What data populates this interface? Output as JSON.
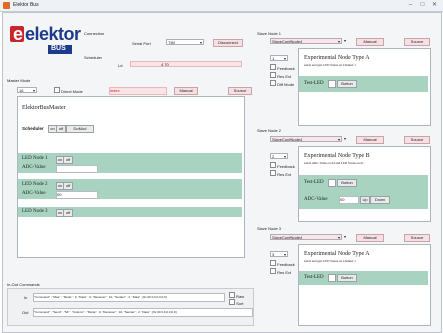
{
  "window": {
    "title": "Elektor Bus",
    "min": "–",
    "max": "□",
    "close": "✕"
  },
  "colors": {
    "accent_red": "#c8262a",
    "node_green": "#a8d3c1",
    "pink": "#f7e0e3"
  },
  "logo": {
    "text": "elektor",
    "sub": "BUS"
  },
  "connection": {
    "title": "Connection",
    "port_label": "Serial Port",
    "port_value": "TIM",
    "disconnect": "Disconnect"
  },
  "scheduler": {
    "title": "Scheduler",
    "label": "Ld",
    "value": "4 70"
  },
  "master_mode": {
    "title": "Master Mode",
    "mode_value": "16",
    "direct_mode": "Direct Mode",
    "cmd_value": "index",
    "manual": "Manual",
    "source": "Source",
    "heading": "ElektorBusMaster",
    "scheduler_label": "Scheduler",
    "on": "on",
    "off": "off",
    "default_btn": "DoMod",
    "led1": "LED Node 1",
    "adc1": "ADC-Value",
    "led2": "LED Node 2",
    "adc2": "ADC-Value",
    "adc2_value": "00",
    "led3": "LED Node 3"
  },
  "in_out": {
    "title": "In-Out Commands",
    "in_label": "In",
    "in_text": "\"Command\" : \"Mas\" : \"Mode\" : 0, \"Data\" : 0, \"Receiver\" : 10, \"Sender\" : 2, \"Data\" : [0x 00 0,0,0,0,0,0]",
    "out_label": "Out",
    "out_text": "\"Command\" : \"Send\" : \"Mi\" : \"Column\" : \"Mode\" : 0, \"Receiver\" : 10, \"Sender\" : 2, \"Data\" : [0x 00 0,0,0,0,0,0]",
    "raw": "Raw",
    "sort": "Sort"
  },
  "slaves": [
    {
      "title": "Slave Node 1",
      "dropdown": "SlaveConfNode4",
      "manual": "Manual",
      "source": "Source",
      "addr": "1",
      "opts": [
        "Feedback",
        "Res Ext",
        "Diff Mode"
      ],
      "heading": "Experimental Node Type A",
      "desc": "sends and gets LED Status on Channel 1",
      "led_label": "Test-LED",
      "button": "Button"
    },
    {
      "title": "Slave Node 2",
      "dropdown": "SlaveConfNode4",
      "manual": "Manual",
      "source": "Source",
      "addr": "2",
      "opts": [
        "Feedback",
        "Res Ext"
      ],
      "heading": "Experimental Node Type B",
      "desc": "sends ADC-Value on #4 and LED Status on #1",
      "led_label": "Test-LED",
      "button": "Button",
      "adc_label": "ADC-Value",
      "adc_value": "00",
      "up": "Up",
      "down": "Down"
    },
    {
      "title": "Slave Node 3",
      "dropdown": "SlaveConfNode4",
      "manual": "Manual",
      "source": "Source",
      "addr": "3",
      "opts": [
        "Feedback",
        "Res Ext"
      ],
      "heading": "Experimental Node Type A",
      "desc": "sends and gets LED Status on Channel 1",
      "led_label": "Test-LED",
      "button": "Button"
    }
  ]
}
